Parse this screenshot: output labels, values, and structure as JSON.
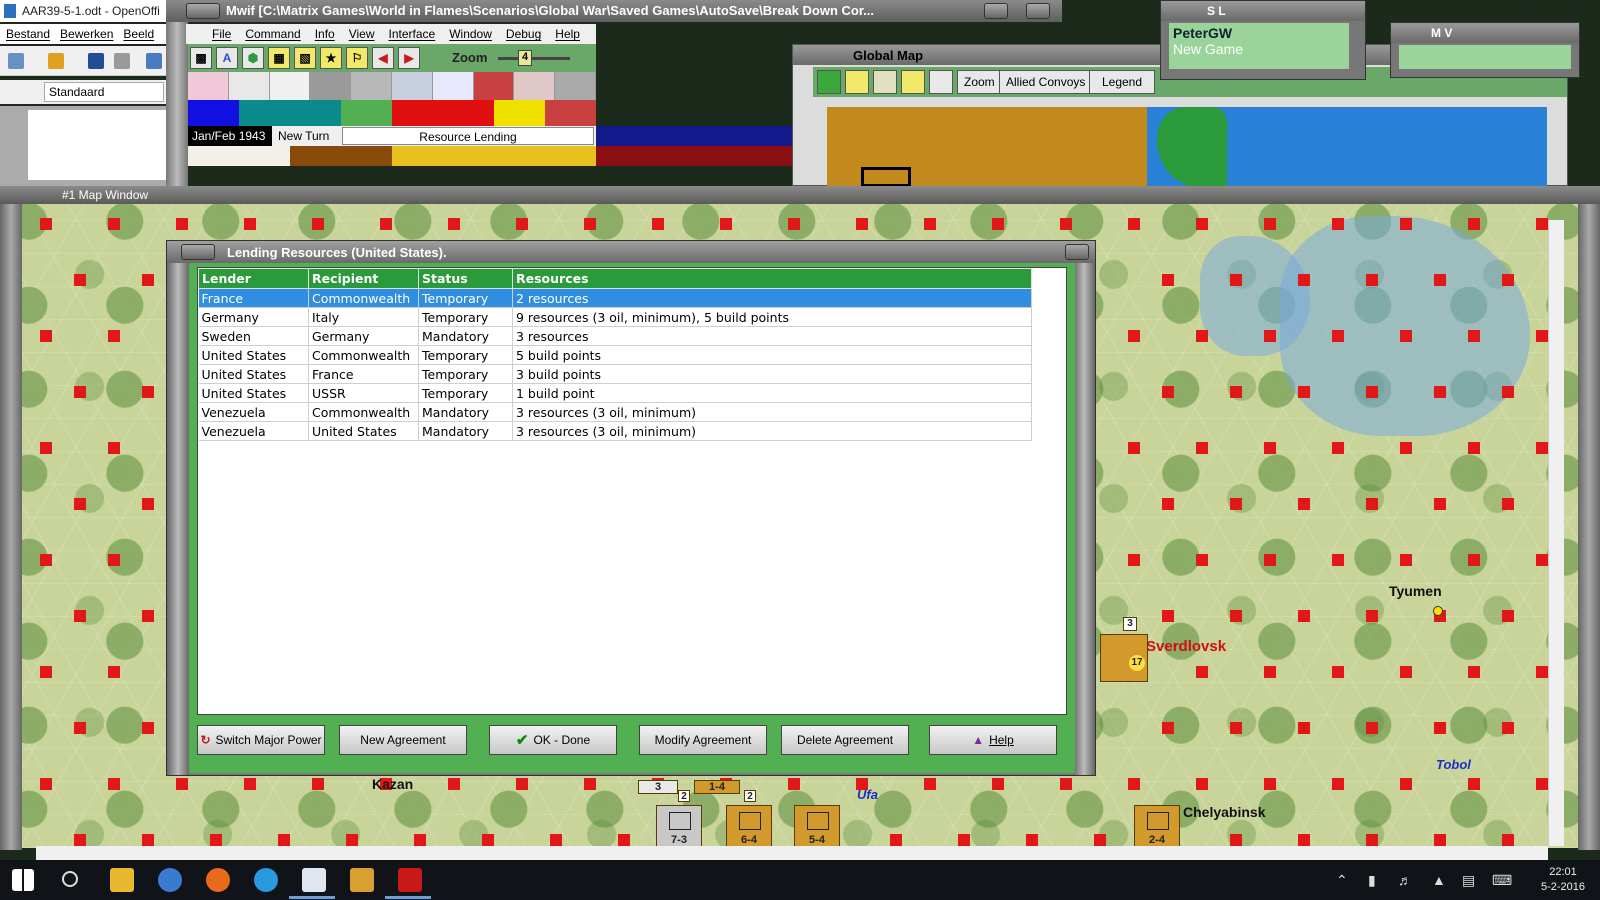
{
  "openoffice": {
    "title": "AAR39-5-1.odt - OpenOffi",
    "menu": [
      "Bestand",
      "Bewerken",
      "Beeld"
    ],
    "style_value": "Standaard"
  },
  "mwif": {
    "title": "Mwif [C:\\Matrix Games\\World in Flames\\Scenarios\\Global War\\Saved Games\\AutoSave\\Break Down Cor...",
    "menu": [
      "File",
      "Command",
      "Info",
      "View",
      "Interface",
      "Window",
      "Debug",
      "Help"
    ],
    "zoom_label": "Zoom",
    "zoom_value": "4",
    "date": "Jan/Feb 1943",
    "turn": "New Turn",
    "phase": "Resource Lending"
  },
  "global_map": {
    "title": "Global Map",
    "buttons": [
      "Zoom",
      "Allied Convoys",
      "Legend"
    ]
  },
  "player_window_1": {
    "title": "S L",
    "player": "PeterGW",
    "status": "New Game"
  },
  "player_window_2": {
    "title": "M V"
  },
  "map_window": {
    "title": "#1 Map Window",
    "cities": {
      "tyumen": "Tyumen",
      "sverdlovsk": "Sverdlovsk",
      "kazan": "Kazan",
      "ufa": "Ufa",
      "chelyabinsk": "Chelyabinsk",
      "tobol": "Tobol"
    },
    "counters": [
      "7-3",
      "6-4",
      "5-4",
      "2-4",
      "3",
      "1-4",
      "2",
      "3",
      "2"
    ]
  },
  "dialog": {
    "title": "Lending Resources (United States).",
    "columns": [
      "Lender",
      "Recipient",
      "Status",
      "Resources"
    ],
    "rows": [
      {
        "lender": "France",
        "recipient": "Commonwealth",
        "status": "Temporary",
        "resources": "2 resources",
        "selected": true
      },
      {
        "lender": "Germany",
        "recipient": "Italy",
        "status": "Temporary",
        "resources": "9 resources (3 oil, minimum), 5 build points"
      },
      {
        "lender": "Sweden",
        "recipient": "Germany",
        "status": "Mandatory",
        "resources": "3 resources"
      },
      {
        "lender": "United States",
        "recipient": "Commonwealth",
        "status": "Temporary",
        "resources": "5 build points"
      },
      {
        "lender": "United States",
        "recipient": "France",
        "status": "Temporary",
        "resources": "3 build points"
      },
      {
        "lender": "United States",
        "recipient": "USSR",
        "status": "Temporary",
        "resources": "1 build point"
      },
      {
        "lender": "Venezuela",
        "recipient": "Commonwealth",
        "status": "Mandatory",
        "resources": "3 resources (3 oil, minimum)"
      },
      {
        "lender": "Venezuela",
        "recipient": "United States",
        "status": "Mandatory",
        "resources": "3 resources (3 oil, minimum)"
      }
    ],
    "buttons": {
      "switch": "Switch Major Power",
      "new": "New Agreement",
      "ok": "OK - Done",
      "modify": "Modify Agreement",
      "delete": "Delete Agreement",
      "help": "Help"
    }
  },
  "taskbar": {
    "time": "22:01",
    "date": "5-2-2016"
  },
  "colors": {
    "dialog_green": "#52b052",
    "header_green": "#2a9a3a",
    "selection_blue": "#2f8ee0",
    "map_dot_red": "#e01818"
  }
}
